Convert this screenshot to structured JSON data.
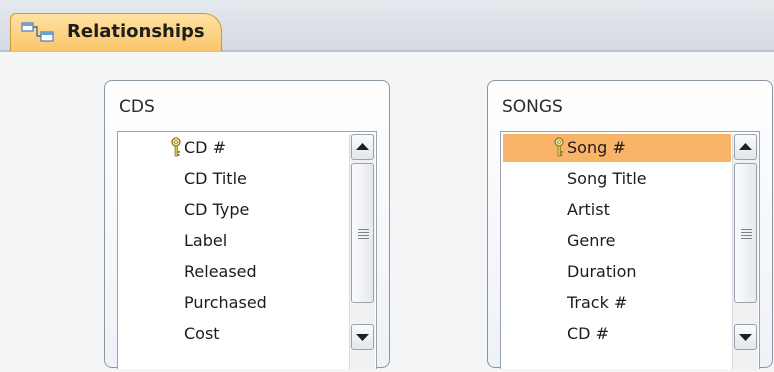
{
  "tab": {
    "label": "Relationships",
    "icon": "relationships-icon"
  },
  "tables": [
    {
      "title": "CDS",
      "fields": [
        {
          "name": "CD #",
          "primary_key": true,
          "selected": false
        },
        {
          "name": "CD Title"
        },
        {
          "name": "CD Type"
        },
        {
          "name": "Label"
        },
        {
          "name": "Released"
        },
        {
          "name": "Purchased"
        },
        {
          "name": "Cost"
        }
      ]
    },
    {
      "title": "SONGS",
      "fields": [
        {
          "name": "Song #",
          "primary_key": true,
          "selected": true
        },
        {
          "name": "Song Title"
        },
        {
          "name": "Artist"
        },
        {
          "name": "Genre"
        },
        {
          "name": "Duration"
        },
        {
          "name": "Track #"
        },
        {
          "name": "CD #"
        }
      ]
    }
  ],
  "colors": {
    "tab_fill": "#f9c66c",
    "selected_row": "#f9b469",
    "window_border": "#8b96a3"
  }
}
